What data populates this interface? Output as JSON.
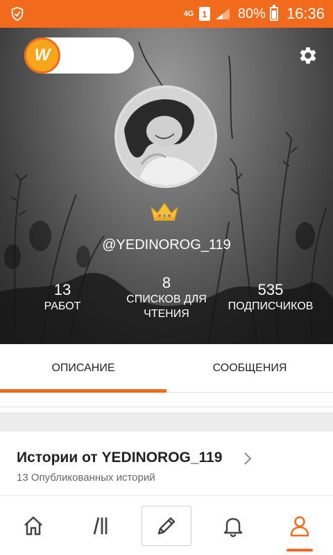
{
  "status_bar": {
    "network": "4G",
    "sim": "1",
    "battery": "80%",
    "time": "16:36",
    "color": "#f26b1d"
  },
  "header": {
    "logo_letter": "W",
    "username": "@YEDINOROG_119",
    "stats": {
      "works": {
        "value": "13",
        "label": "РАБОТ"
      },
      "lists": {
        "value": "8",
        "label": "СПИСКОВ ДЛЯ ЧТЕНИЯ"
      },
      "followers": {
        "value": "535",
        "label": "ПОДПИСЧИКОВ"
      }
    }
  },
  "tabs": {
    "about": "ОПИСАНИЕ",
    "messages": "СООБЩЕНИЯ",
    "active": "about"
  },
  "stories": {
    "title": "Истории от YEDINOROG_119",
    "subtitle": "13 Опубликованных историй"
  },
  "bottom_nav": {
    "icons": [
      "home-icon",
      "library-icon",
      "pencil-icon",
      "bell-icon",
      "profile-icon"
    ],
    "active": "profile-icon",
    "accent": "#f26b1d"
  }
}
